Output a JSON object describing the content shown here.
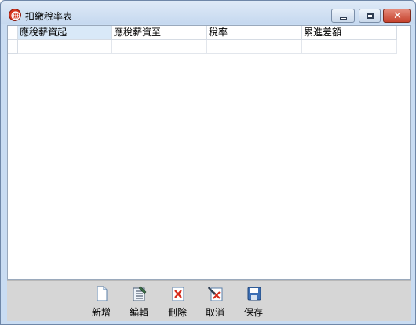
{
  "window": {
    "title": "扣繳稅率表"
  },
  "grid": {
    "columns": [
      "應稅薪資起",
      "應稅薪資至",
      "稅率",
      "累進差額"
    ],
    "rows": [
      [
        "",
        "",
        "",
        ""
      ]
    ]
  },
  "toolbar": {
    "new_label": "新增",
    "edit_label": "編輯",
    "delete_label": "刪除",
    "cancel_label": "取消",
    "save_label": "保存"
  }
}
